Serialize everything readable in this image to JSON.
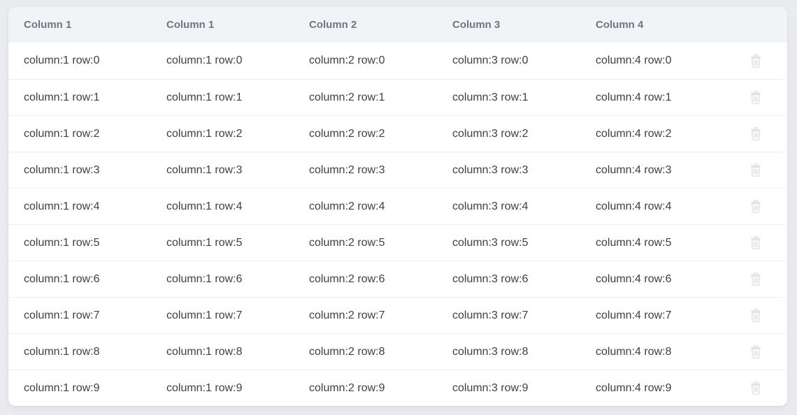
{
  "table": {
    "headers": [
      "Column 1",
      "Column 1",
      "Column 2",
      "Column 3",
      "Column 4"
    ],
    "rows": [
      [
        "column:1 row:0",
        "column:1 row:0",
        "column:2 row:0",
        "column:3 row:0",
        "column:4 row:0"
      ],
      [
        "column:1 row:1",
        "column:1 row:1",
        "column:2 row:1",
        "column:3 row:1",
        "column:4 row:1"
      ],
      [
        "column:1 row:2",
        "column:1 row:2",
        "column:2 row:2",
        "column:3 row:2",
        "column:4 row:2"
      ],
      [
        "column:1 row:3",
        "column:1 row:3",
        "column:2 row:3",
        "column:3 row:3",
        "column:4 row:3"
      ],
      [
        "column:1 row:4",
        "column:1 row:4",
        "column:2 row:4",
        "column:3 row:4",
        "column:4 row:4"
      ],
      [
        "column:1 row:5",
        "column:1 row:5",
        "column:2 row:5",
        "column:3 row:5",
        "column:4 row:5"
      ],
      [
        "column:1 row:6",
        "column:1 row:6",
        "column:2 row:6",
        "column:3 row:6",
        "column:4 row:6"
      ],
      [
        "column:1 row:7",
        "column:1 row:7",
        "column:2 row:7",
        "column:3 row:7",
        "column:4 row:7"
      ],
      [
        "column:1 row:8",
        "column:1 row:8",
        "column:2 row:8",
        "column:3 row:8",
        "column:4 row:8"
      ],
      [
        "column:1 row:9",
        "column:1 row:9",
        "column:2 row:9",
        "column:3 row:9",
        "column:4 row:9"
      ]
    ],
    "row_action_icon": "trash-icon",
    "colors": {
      "header_bg": "#f1f4f7",
      "header_text": "#6f7680",
      "cell_text": "#3c4148",
      "icon": "#dde1e6"
    }
  }
}
